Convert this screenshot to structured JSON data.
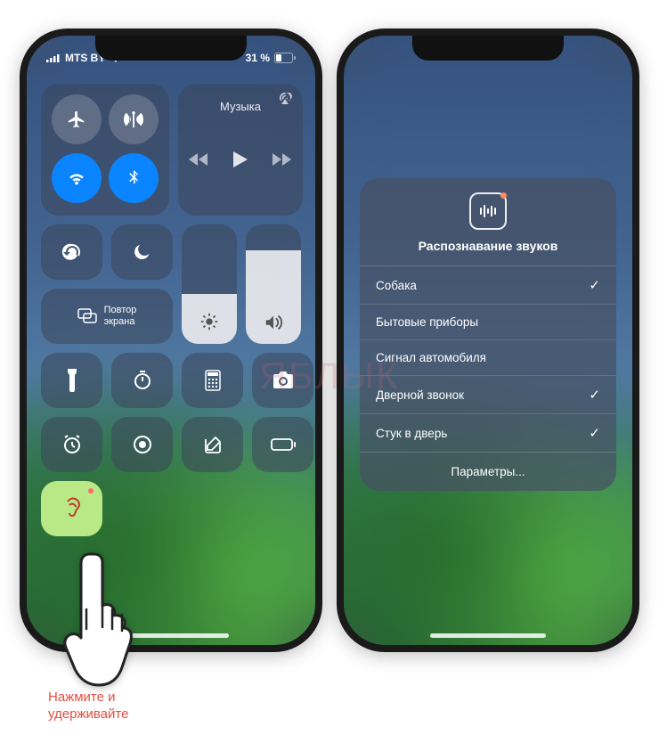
{
  "statusbar": {
    "carrier": "MTS BY",
    "battery_percent": "31 %"
  },
  "music": {
    "label": "Музыка"
  },
  "screen_mirroring": {
    "line1": "Повтор",
    "line2": "экрана"
  },
  "brightness": {
    "fill_percent": 42
  },
  "volume": {
    "fill_percent": 78
  },
  "sound_recognition": {
    "title": "Распознавание звуков",
    "items": [
      {
        "label": "Собака",
        "checked": true
      },
      {
        "label": "Бытовые приборы",
        "checked": false
      },
      {
        "label": "Сигнал автомобиля",
        "checked": false
      },
      {
        "label": "Дверной звонок",
        "checked": true
      },
      {
        "label": "Стук в дверь",
        "checked": true
      }
    ],
    "settings_label": "Параметры..."
  },
  "hint": {
    "text": "Нажмите и\nудерживайте"
  },
  "watermark": "ЯБЛЫК",
  "colors": {
    "accent_blue": "#0a84ff",
    "sound_tile_bg": "#b8e986",
    "hint_text": "#e74c3c"
  }
}
